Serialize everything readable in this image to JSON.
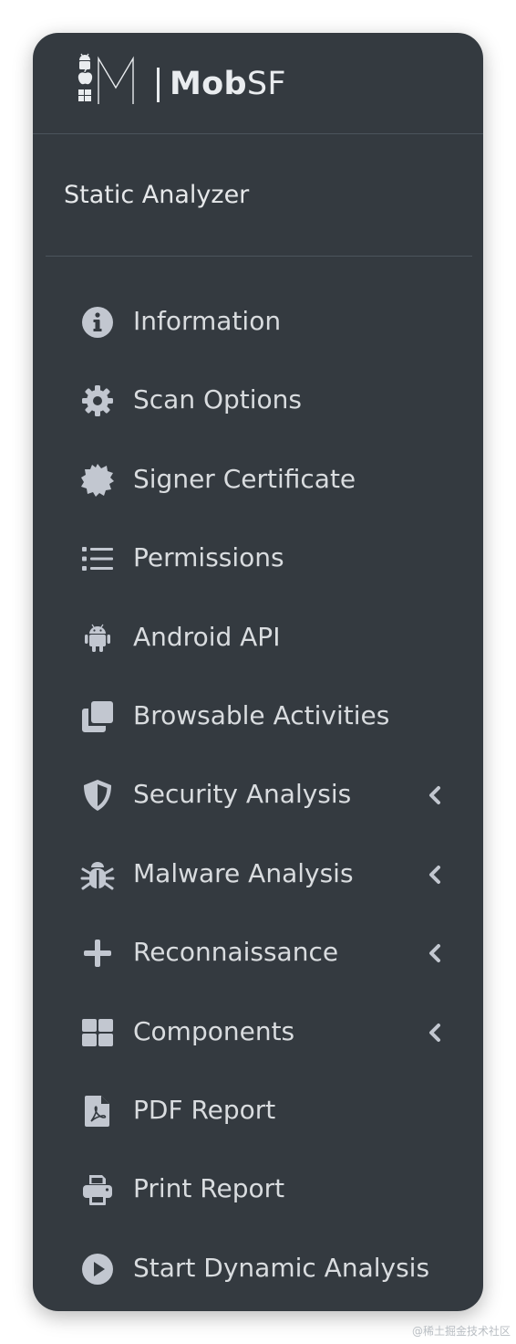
{
  "theme": {
    "sidebar_bg": "#343a40",
    "text": "#d9dcdf",
    "icon": "#c2c7d0",
    "divider": "#4b545c"
  },
  "brand": {
    "name_bold": "Mob",
    "name_light": "SF",
    "logo_icon": "mobsf-logo-icon"
  },
  "section": {
    "title": "Static Analyzer"
  },
  "nav": {
    "items": [
      {
        "label": "Information",
        "icon": "info-circle-icon",
        "has_submenu": false
      },
      {
        "label": "Scan Options",
        "icon": "gear-icon",
        "has_submenu": false
      },
      {
        "label": "Signer Certificate",
        "icon": "certificate-icon",
        "has_submenu": false
      },
      {
        "label": "Permissions",
        "icon": "list-icon",
        "has_submenu": false
      },
      {
        "label": "Android API",
        "icon": "android-icon",
        "has_submenu": false
      },
      {
        "label": "Browsable Activities",
        "icon": "clone-icon",
        "has_submenu": false
      },
      {
        "label": "Security Analysis",
        "icon": "shield-icon",
        "has_submenu": true
      },
      {
        "label": "Malware Analysis",
        "icon": "bug-icon",
        "has_submenu": true
      },
      {
        "label": "Reconnaissance",
        "icon": "plus-icon",
        "has_submenu": true
      },
      {
        "label": "Components",
        "icon": "grid-icon",
        "has_submenu": true
      },
      {
        "label": "PDF Report",
        "icon": "pdf-file-icon",
        "has_submenu": false
      },
      {
        "label": "Print Report",
        "icon": "printer-icon",
        "has_submenu": false
      },
      {
        "label": "Start Dynamic Analysis",
        "icon": "play-circle-icon",
        "has_submenu": false
      }
    ]
  },
  "watermark": "@稀土掘金技术社区"
}
